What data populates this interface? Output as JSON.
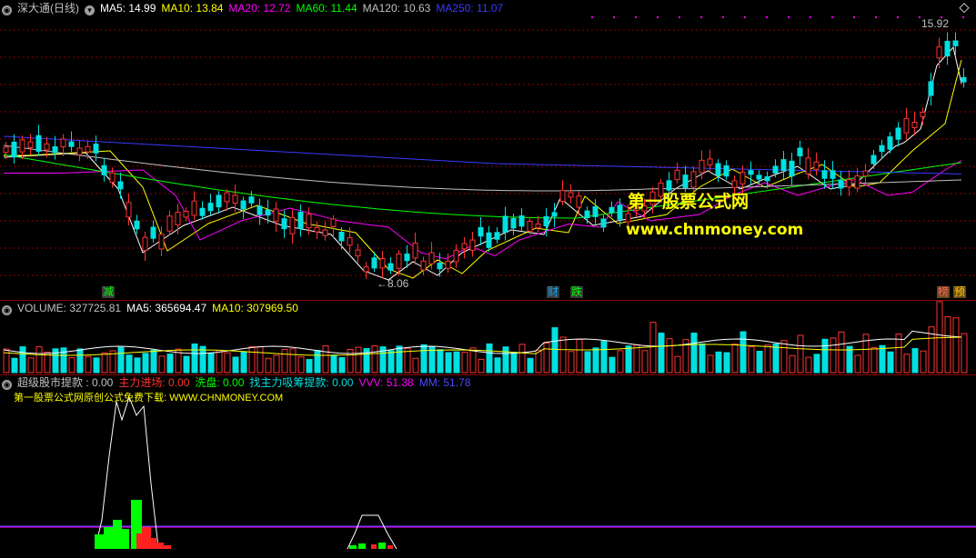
{
  "price_header": {
    "title": "深大通(日线)",
    "ma5": "MA5: 14.99",
    "ma10": "MA10: 13.84",
    "ma20": "MA20: 12.72",
    "ma60": "MA60: 11.44",
    "ma120": "MA120: 10.63",
    "ma250": "MA250: 11.07"
  },
  "price_labels": {
    "high": "15.92",
    "low": "8.06",
    "low_prefix": "←",
    "marker_jian": "减",
    "marker_cai": "财",
    "marker_die": "跌",
    "marker_bang": "榜",
    "marker_yu": "预"
  },
  "watermark": {
    "cn": "第一股票公式网",
    "url": "www.chnmoney.com"
  },
  "volume_header": {
    "volume": "VOLUME: 327725.81",
    "ma5": "MA5: 365694.47",
    "ma10": "MA10: 307969.50"
  },
  "indicator_header": {
    "name": "超级股市提款 : 0.00",
    "main_in": "主力进场: 0.00",
    "wash": "洗盘: 0.00",
    "absorb": "找主力吸筹提款: 0.00",
    "vvv": "VVV: 51.38",
    "mm": "MM: 51.78",
    "subtitle": "第一股票公式网原创公式免费下载:  WWW.CHNMONEY.COM"
  },
  "colors": {
    "up": "#ff3232",
    "down": "#00e0e0",
    "ma5": "#ffffff",
    "ma10": "#ffff00",
    "ma20": "#ff00ff",
    "ma60": "#00ff00",
    "ma120": "#c0c0c0",
    "ma250": "#3a3aff",
    "grid": "#8b0000"
  }
}
